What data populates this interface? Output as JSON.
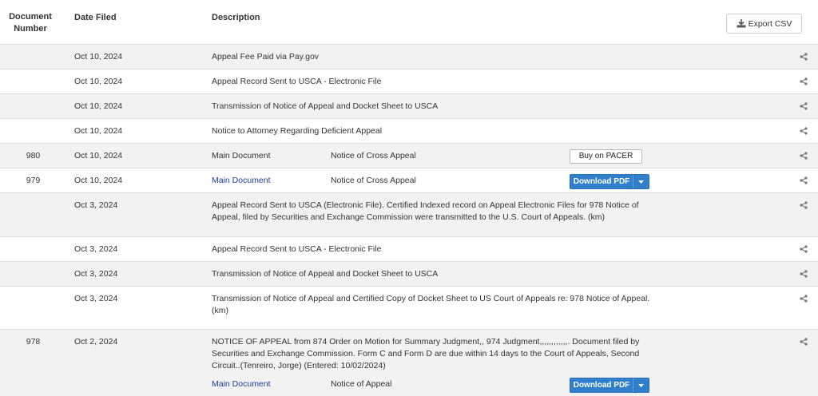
{
  "header": {
    "doc_number": "Document Number",
    "date_filed": "Date Filed",
    "description": "Description",
    "export_label": "Export CSV"
  },
  "rows": [
    {
      "num": "",
      "date": "Oct 10, 2024",
      "desc": "Appeal Fee Paid via Pay.gov"
    },
    {
      "num": "",
      "date": "Oct 10, 2024",
      "desc": "Appeal Record Sent to USCA - Electronic File"
    },
    {
      "num": "",
      "date": "Oct 10, 2024",
      "desc": "Transmission of Notice of Appeal and Docket Sheet to USCA"
    },
    {
      "num": "",
      "date": "Oct 10, 2024",
      "desc": "Notice to Attorney Regarding Deficient Appeal"
    },
    {
      "num": "980",
      "date": "Oct 10, 2024",
      "doc_label": "Main Document",
      "notice": "Notice of Cross Appeal",
      "button": "Buy on PACER"
    },
    {
      "num": "979",
      "date": "Oct 10, 2024",
      "doc_label": "Main Document",
      "notice": "Notice of Cross Appeal",
      "button": "Download PDF"
    },
    {
      "num": "",
      "date": "Oct 3, 2024",
      "desc": "Appeal Record Sent to USCA (Electronic File). Certified Indexed record on Appeal Electronic Files for 978 Notice of Appeal, filed by Securities and Exchange Commission were transmitted to the U.S. Court of Appeals. (km)"
    },
    {
      "num": "",
      "date": "Oct 3, 2024",
      "desc": "Appeal Record Sent to USCA - Electronic File"
    },
    {
      "num": "",
      "date": "Oct 3, 2024",
      "desc": "Transmission of Notice of Appeal and Docket Sheet to USCA"
    },
    {
      "num": "",
      "date": "Oct 3, 2024",
      "desc": "Transmission of Notice of Appeal and Certified Copy of Docket Sheet to US Court of Appeals re: 978 Notice of Appeal. (km)"
    },
    {
      "num": "978",
      "date": "Oct 2, 2024",
      "desc": "NOTICE OF APPEAL from 874 Order on Motion for Summary Judgment,, 974 Judgment,,,,,,,,,,,,. Document filed by Securities and Exchange Commission. Form C and Form D are due within 14 days to the Court of Appeals, Second Circuit..(Tenreiro, Jorge) (Entered: 10/02/2024)",
      "doc_label": "Main Document",
      "notice": "Notice of Appeal",
      "button": "Download PDF"
    }
  ],
  "icons": {
    "share": "share-icon",
    "download": "download-icon",
    "caret": "caret-down-icon"
  },
  "colors": {
    "link": "#1a3ea0",
    "download_button": "#2f7fcc",
    "row_stripe": "#f2f2f2"
  }
}
